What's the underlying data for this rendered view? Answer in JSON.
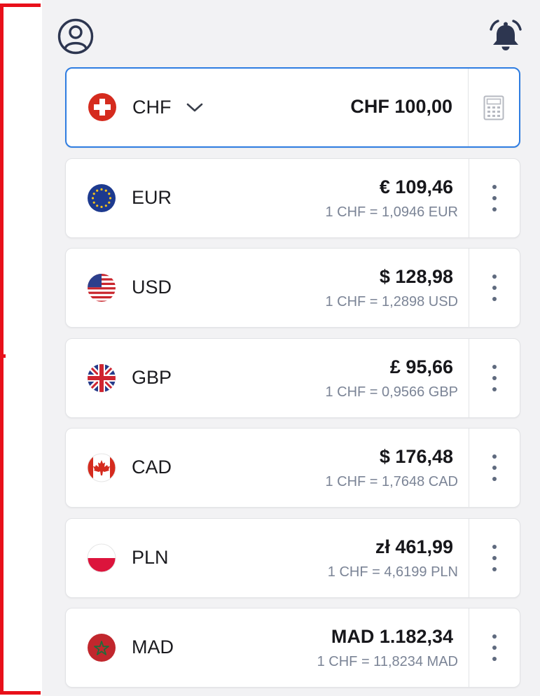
{
  "colors": {
    "accent": "#2f7de1",
    "annotation": "#e8101a",
    "background": "#f2f2f4",
    "rate_text": "#7b8496"
  },
  "topbar": {
    "profile_icon": "user-circle-icon",
    "notifications_icon": "bell-icon"
  },
  "base": {
    "flag_icon": "switzerland-flag-icon",
    "code": "CHF",
    "dropdown_icon": "chevron-down-icon",
    "amount": "CHF 100,00",
    "calculator_icon": "calculator-icon"
  },
  "conversions": [
    {
      "flag_icon": "eu-flag-icon",
      "code": "EUR",
      "amount": "€ 109,46",
      "rate": "1 CHF = 1,0946 EUR"
    },
    {
      "flag_icon": "us-flag-icon",
      "code": "USD",
      "amount": "$ 128,98",
      "rate": "1 CHF = 1,2898 USD"
    },
    {
      "flag_icon": "uk-flag-icon",
      "code": "GBP",
      "amount": "£ 95,66",
      "rate": "1 CHF = 0,9566 GBP"
    },
    {
      "flag_icon": "canada-flag-icon",
      "code": "CAD",
      "amount": "$ 176,48",
      "rate": "1 CHF = 1,7648 CAD"
    },
    {
      "flag_icon": "poland-flag-icon",
      "code": "PLN",
      "amount": "zł 461,99",
      "rate": "1 CHF = 4,6199 PLN"
    },
    {
      "flag_icon": "morocco-flag-icon",
      "code": "MAD",
      "amount": "MAD 1.182,34",
      "rate": "1 CHF = 11,8234 MAD"
    }
  ]
}
